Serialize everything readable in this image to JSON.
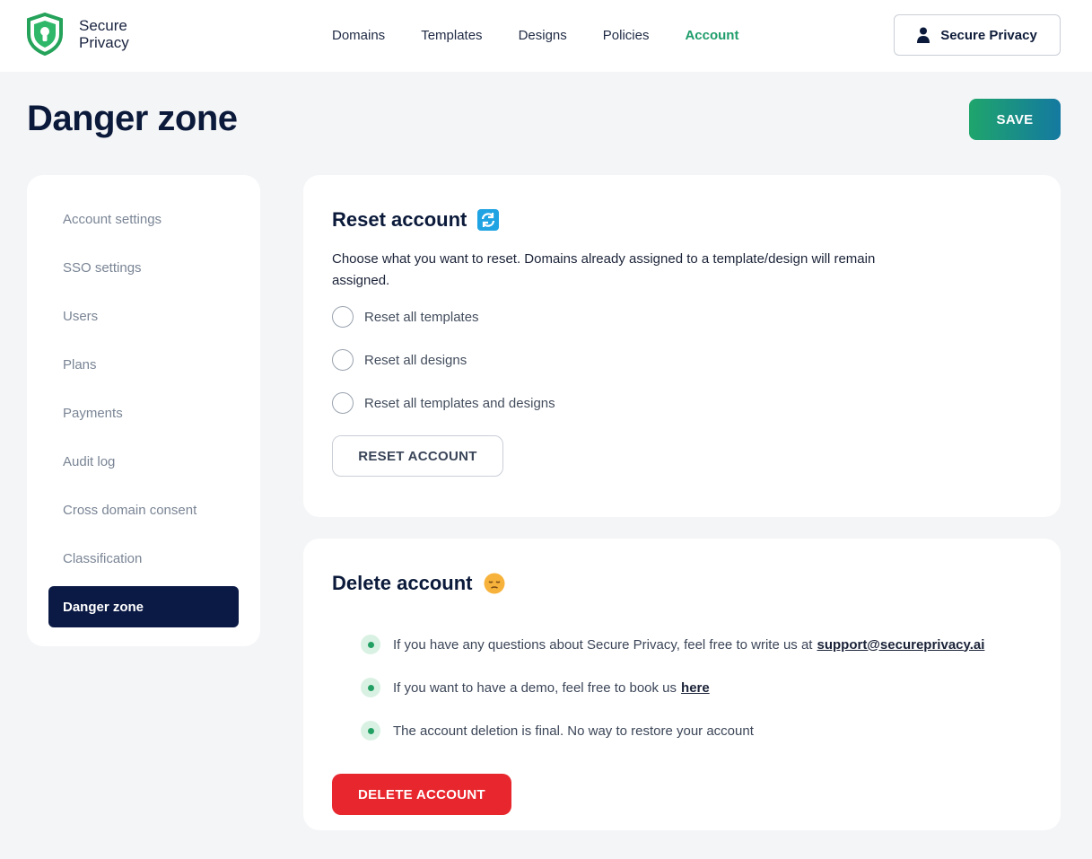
{
  "brand": {
    "name_line1": "Secure",
    "name_line2": "Privacy",
    "accent": "#1f9d6b"
  },
  "nav": {
    "items": [
      {
        "label": "Domains"
      },
      {
        "label": "Templates"
      },
      {
        "label": "Designs"
      },
      {
        "label": "Policies"
      },
      {
        "label": "Account",
        "active": true
      }
    ]
  },
  "user": {
    "label": "Secure Privacy",
    "icon": "user-icon"
  },
  "page": {
    "title": "Danger zone",
    "save_label": "SAVE"
  },
  "sidebar": {
    "items": [
      {
        "label": "Account settings"
      },
      {
        "label": "SSO settings"
      },
      {
        "label": "Users"
      },
      {
        "label": "Plans"
      },
      {
        "label": "Payments"
      },
      {
        "label": "Audit log"
      },
      {
        "label": "Cross domain consent"
      },
      {
        "label": "Classification"
      },
      {
        "label": "Danger zone",
        "active": true
      }
    ]
  },
  "reset": {
    "title": "Reset account",
    "icon": "refresh-icon",
    "description": "Choose what you want to reset. Domains already assigned to a template/design will remain assigned.",
    "options": [
      {
        "label": "Reset all templates"
      },
      {
        "label": "Reset all designs"
      },
      {
        "label": "Reset all templates and designs"
      }
    ],
    "button_label": "RESET ACCOUNT"
  },
  "delete": {
    "title": "Delete account",
    "icon": "pensive-face-icon",
    "bullets": {
      "b1_text": "If you have any questions about Secure Privacy, feel free to write us at",
      "b1_link": "support@secureprivacy.ai",
      "b2_text": "If you want to have a demo, feel free to book us",
      "b2_link": "here",
      "b3_text": "The account deletion is final. No way to restore your account"
    },
    "button_label": "DELETE ACCOUNT"
  }
}
